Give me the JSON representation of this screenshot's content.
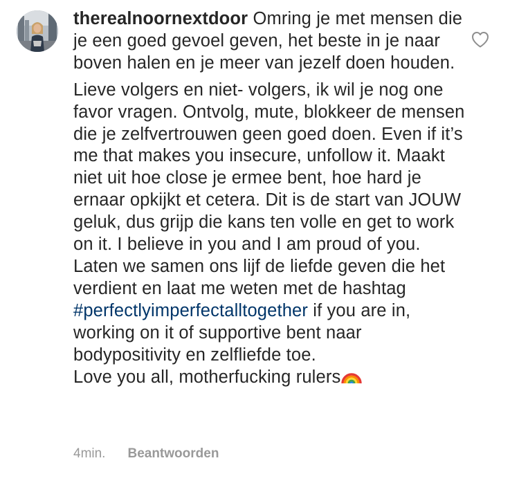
{
  "comment": {
    "username": "therealnoornextdoor",
    "intro": "Omring je met mensen die je een goed gevoel geven, het beste in je naar boven halen en je meer van jezelf doen houden.",
    "paragraph2_before_hashtag": "Lieve volgers en niet- volgers, ik wil je nog one favor vragen. Ontvolg, mute, blokkeer de mensen die je zelfvertrouwen geen goed doen. Even if it’s me that makes you insecure, unfollow it. Maakt niet uit hoe close je ermee bent, hoe hard je ernaar opkijkt et cetera. Dit is de start van JOUW geluk, dus grijp die kans ten volle en get to work on it. I believe in you and I am proud of you. Laten we samen ons lijf de liefde geven die het verdient en laat me weten met de hashtag",
    "hashtag": "#perfectlyimperfectalltogether",
    "paragraph2_after_hashtag": " if you are in, working on it of supportive bent naar bodypositivity en zelfliefde toe.",
    "closing": "Love you all, motherfucking rulers",
    "closing_emoji": "rainbow-icon"
  },
  "meta": {
    "time": "4min.",
    "reply_label": "Beantwoorden"
  },
  "icons": {
    "like": "heart-icon",
    "avatar": "avatar"
  },
  "colors": {
    "text": "#262626",
    "hashtag": "#003569",
    "meta": "#999999"
  }
}
